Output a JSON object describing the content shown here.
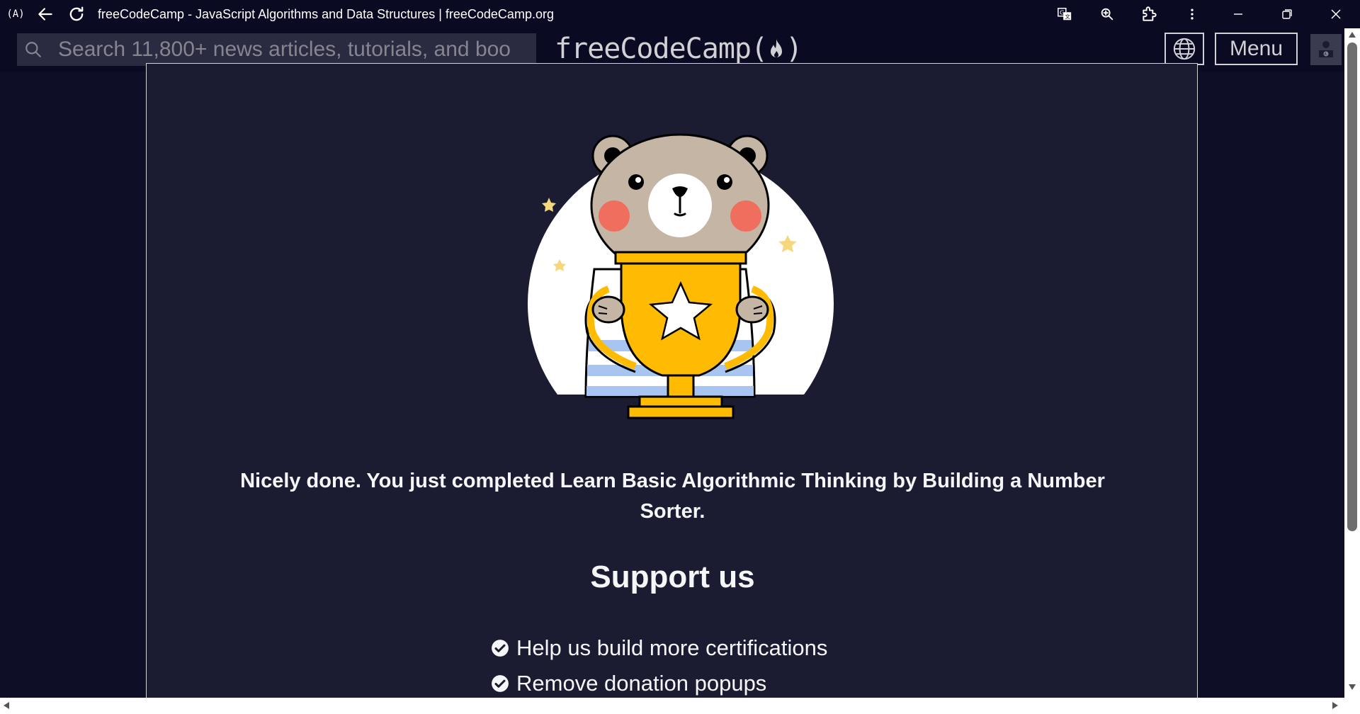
{
  "browser": {
    "app_logo": "(A)",
    "title": "freeCodeCamp - JavaScript Algorithms and Data Structures | freeCodeCamp.org",
    "icons": [
      "back-arrow-icon",
      "reload-icon",
      "translate-icon",
      "zoom-icon",
      "extensions-icon",
      "more-vert-icon",
      "minimize-icon",
      "restore-icon",
      "close-icon"
    ]
  },
  "nav": {
    "search_placeholder": "Search 11,800+ news articles, tutorials, and boo",
    "brand_text": "freeCodeCamp(",
    "brand_close": ")",
    "menu_label": "Menu"
  },
  "modal": {
    "completion_text": "Nicely done. You just completed Learn Basic Algorithmic Thinking by Building a Number Sorter.",
    "support_title": "Support us",
    "benefits": [
      "Help us build more certifications",
      "Remove donation popups"
    ]
  },
  "colors": {
    "bg": "#0a0a23",
    "modal_bg": "#1b1b32",
    "trophy": "#febb02",
    "cheek": "#f06e5e"
  }
}
